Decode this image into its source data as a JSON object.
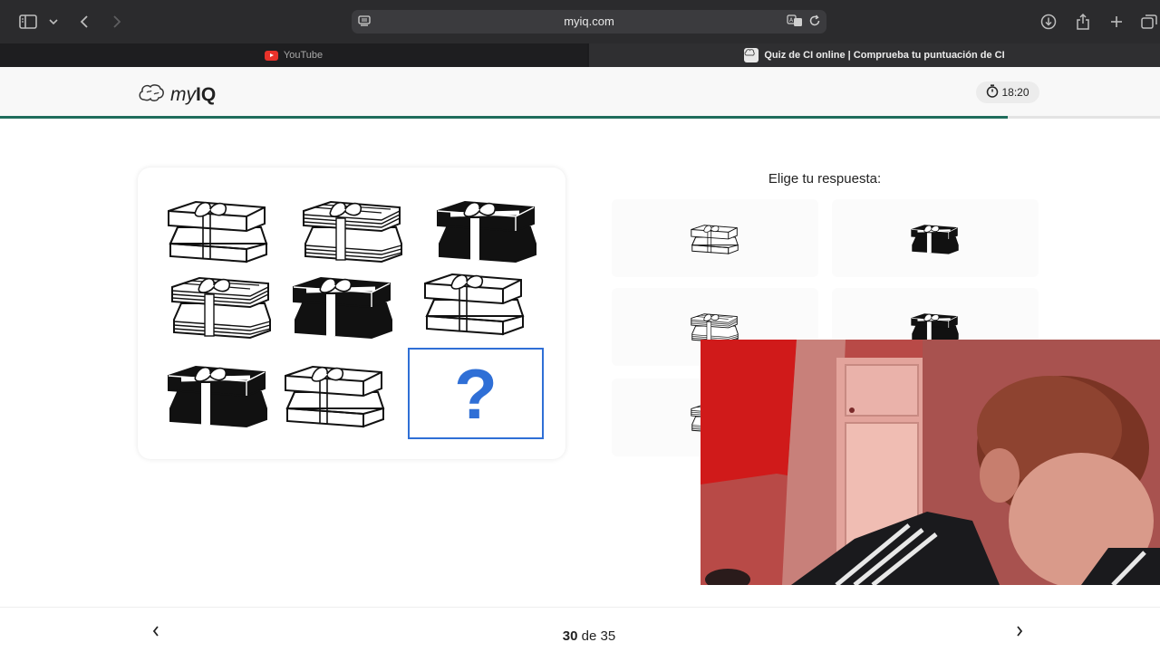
{
  "browser": {
    "url": "myiq.com",
    "tabs": [
      {
        "label": "YouTube",
        "active": false
      },
      {
        "label": "Quiz de CI online | Comprueba tu puntuación de CI",
        "active": true
      }
    ]
  },
  "header": {
    "logo_prefix": "my",
    "logo_suffix": "IQ",
    "timer": "18:20"
  },
  "progress": {
    "current": 30,
    "total": 35,
    "fraction": 0.869
  },
  "puzzle": {
    "cells": [
      {
        "icon": "gift-box-white-icon"
      },
      {
        "icon": "gift-box-striped-icon"
      },
      {
        "icon": "gift-box-black-icon"
      },
      {
        "icon": "gift-box-striped-icon"
      },
      {
        "icon": "gift-box-black-icon"
      },
      {
        "icon": "gift-box-white-icon"
      },
      {
        "icon": "gift-box-black-icon"
      },
      {
        "icon": "gift-box-white-icon"
      }
    ],
    "missing_symbol": "?"
  },
  "answers": {
    "title": "Elige tu respuesta:",
    "options": [
      {
        "icon": "gift-box-white-icon"
      },
      {
        "icon": "gift-box-black-icon"
      },
      {
        "icon": "gift-box-striped-icon"
      },
      {
        "icon": "gift-box-black-icon"
      },
      {
        "icon": "gift-box-striped-icon"
      },
      {
        "icon": "gift-box-black-icon"
      }
    ]
  },
  "footer": {
    "current": "30",
    "separator": "de",
    "total": "35"
  },
  "colors": {
    "accent": "#2f6fd6",
    "progress": "#1f6d5c",
    "chrome": "#2b2b2d"
  }
}
